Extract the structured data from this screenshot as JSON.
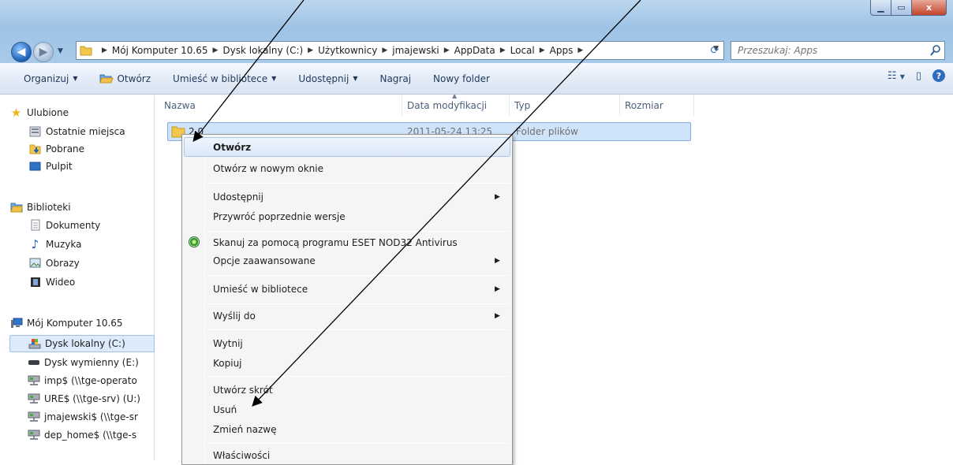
{
  "window": {
    "controls": {
      "minimize": "▁",
      "maximize": "▭",
      "close": "x"
    }
  },
  "nav": {
    "back_icon": "back-arrow-icon",
    "forward_icon": "forward-arrow-icon"
  },
  "address": {
    "crumbs": [
      "Mój Komputer 10.65",
      "Dysk lokalny (C:)",
      "Użytkownicy",
      "jmajewski",
      "AppData",
      "Local",
      "Apps"
    ]
  },
  "search": {
    "placeholder": "Przeszukaj: Apps"
  },
  "toolbar": {
    "organize": "Organizuj",
    "open": "Otwórz",
    "library": "Umieść w bibliotece",
    "share": "Udostępnij",
    "burn": "Nagraj",
    "new_folder": "Nowy folder"
  },
  "sidebar": {
    "favorites": {
      "header": "Ulubione",
      "items": [
        "Ostatnie miejsca",
        "Pobrane",
        "Pulpit"
      ]
    },
    "libraries": {
      "header": "Biblioteki",
      "items": [
        "Dokumenty",
        "Muzyka",
        "Obrazy",
        "Wideo"
      ]
    },
    "computer": {
      "header": "Mój Komputer 10.65",
      "items": [
        "Dysk lokalny (C:)",
        "Dysk wymienny (E:)",
        "imp$ (\\\\tge-operato",
        "URE$ (\\\\tge-srv) (U:)",
        "jmajewski$ (\\\\tge-sr",
        "dep_home$ (\\\\tge-s"
      ]
    }
  },
  "columns": {
    "name": "Nazwa",
    "date": "Data modyfikacji",
    "type": "Typ",
    "size": "Rozmiar"
  },
  "file": {
    "name": "2.0",
    "date": "2011-05-24 13:25",
    "type": "Folder plików"
  },
  "context_menu": {
    "open": "Otwórz",
    "open_new": "Otwórz w nowym oknie",
    "share": "Udostępnij",
    "restore": "Przywróć poprzednie wersje",
    "eset": "Skanuj za pomocą programu ESET NOD32 Antivirus",
    "advanced": "Opcje zaawansowane",
    "library": "Umieść w bibliotece",
    "send_to": "Wyślij do",
    "cut": "Wytnij",
    "copy": "Kopiuj",
    "shortcut": "Utwórz skrót",
    "delete": "Usuń",
    "rename": "Zmień nazwę",
    "properties": "Właściwości"
  },
  "colors": {
    "accent": "#cfe3fb",
    "selection_border": "#84acdd",
    "aero": "#a9cbe9"
  }
}
